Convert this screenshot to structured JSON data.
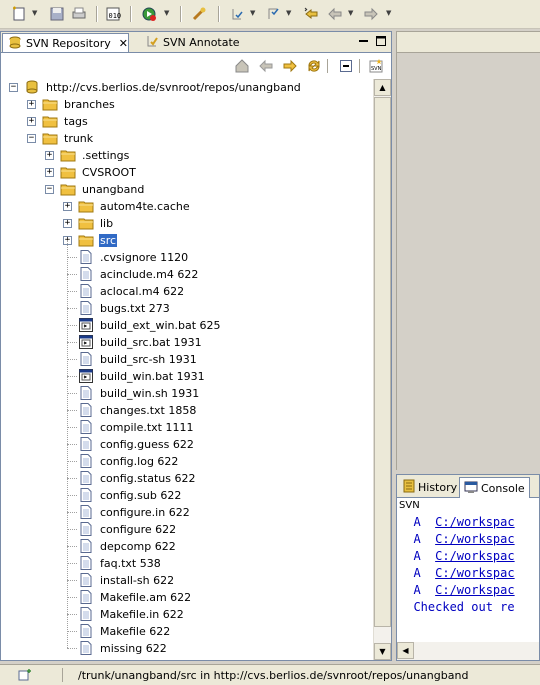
{
  "toolbar": {
    "icons": [
      "new-icon",
      "save-icon",
      "print-icon",
      "open-type-icon",
      "run-icon",
      "dropdown-icon",
      "external-tools-icon",
      "annotation-icon",
      "last-edit-icon",
      "back-icon",
      "forward-icon"
    ]
  },
  "left_panel": {
    "tabs": [
      {
        "label": "SVN Repository",
        "active": true
      },
      {
        "label": "SVN Annotate",
        "active": false
      }
    ]
  },
  "tree": {
    "root": {
      "label": "http://cvs.berlios.de/svnroot/repos/unangband"
    },
    "items": [
      {
        "label": "branches",
        "type": "folder",
        "depth": 1,
        "state": "collapsed"
      },
      {
        "label": "tags",
        "type": "folder",
        "depth": 1,
        "state": "collapsed"
      },
      {
        "label": "trunk",
        "type": "folder",
        "depth": 1,
        "state": "expanded"
      },
      {
        "label": ".settings",
        "type": "folder",
        "depth": 2,
        "state": "collapsed"
      },
      {
        "label": "CVSROOT",
        "type": "folder",
        "depth": 2,
        "state": "collapsed"
      },
      {
        "label": "unangband",
        "type": "folder",
        "depth": 2,
        "state": "expanded"
      },
      {
        "label": "autom4te.cache",
        "type": "folder",
        "depth": 3,
        "state": "collapsed"
      },
      {
        "label": "lib",
        "type": "folder",
        "depth": 3,
        "state": "collapsed"
      },
      {
        "label": "src",
        "type": "folder",
        "depth": 3,
        "state": "collapsed",
        "selected": true
      },
      {
        "label": ".cvsignore 1120",
        "type": "file",
        "depth": 3
      },
      {
        "label": "acinclude.m4 622",
        "type": "file",
        "depth": 3
      },
      {
        "label": "aclocal.m4 622",
        "type": "file",
        "depth": 3
      },
      {
        "label": "bugs.txt 273",
        "type": "file",
        "depth": 3
      },
      {
        "label": "build_ext_win.bat 625",
        "type": "bat",
        "depth": 3
      },
      {
        "label": "build_src.bat 1931",
        "type": "bat",
        "depth": 3
      },
      {
        "label": "build_src-sh 1931",
        "type": "file",
        "depth": 3
      },
      {
        "label": "build_win.bat 1931",
        "type": "bat",
        "depth": 3
      },
      {
        "label": "build_win.sh 1931",
        "type": "file",
        "depth": 3
      },
      {
        "label": "changes.txt 1858",
        "type": "file",
        "depth": 3
      },
      {
        "label": "compile.txt 1111",
        "type": "file",
        "depth": 3
      },
      {
        "label": "config.guess 622",
        "type": "file",
        "depth": 3
      },
      {
        "label": "config.log 622",
        "type": "file",
        "depth": 3
      },
      {
        "label": "config.status 622",
        "type": "file",
        "depth": 3
      },
      {
        "label": "config.sub 622",
        "type": "file",
        "depth": 3
      },
      {
        "label": "configure.in 622",
        "type": "file",
        "depth": 3
      },
      {
        "label": "configure 622",
        "type": "file",
        "depth": 3
      },
      {
        "label": "depcomp 622",
        "type": "file",
        "depth": 3
      },
      {
        "label": "faq.txt 538",
        "type": "file",
        "depth": 3
      },
      {
        "label": "install-sh 622",
        "type": "file",
        "depth": 3
      },
      {
        "label": "Makefile.am 622",
        "type": "file",
        "depth": 3
      },
      {
        "label": "Makefile.in 622",
        "type": "file",
        "depth": 3
      },
      {
        "label": "Makefile 622",
        "type": "file",
        "depth": 3
      },
      {
        "label": "missing 622",
        "type": "file",
        "depth": 3
      }
    ]
  },
  "console": {
    "tabs": [
      {
        "label": "History",
        "active": false
      },
      {
        "label": "Console",
        "active": true
      }
    ],
    "name": "SVN",
    "lines": [
      {
        "prefix": "  A  ",
        "link": "C:/workspac"
      },
      {
        "prefix": "  A  ",
        "link": "C:/workspac"
      },
      {
        "prefix": "  A  ",
        "link": "C:/workspac"
      },
      {
        "prefix": "  A  ",
        "link": "C:/workspac"
      },
      {
        "prefix": "  A  ",
        "link": "C:/workspac"
      },
      {
        "prefix": "  ",
        "text": "Checked out re"
      }
    ]
  },
  "status_bar": {
    "text": "/trunk/unangband/src in http://cvs.berlios.de/svnroot/repos/unangband"
  },
  "colors": {
    "selection": "#316ac5",
    "console_text": "#0000c0",
    "folder": "#f0c040",
    "panel_bg": "#ece9d8"
  }
}
